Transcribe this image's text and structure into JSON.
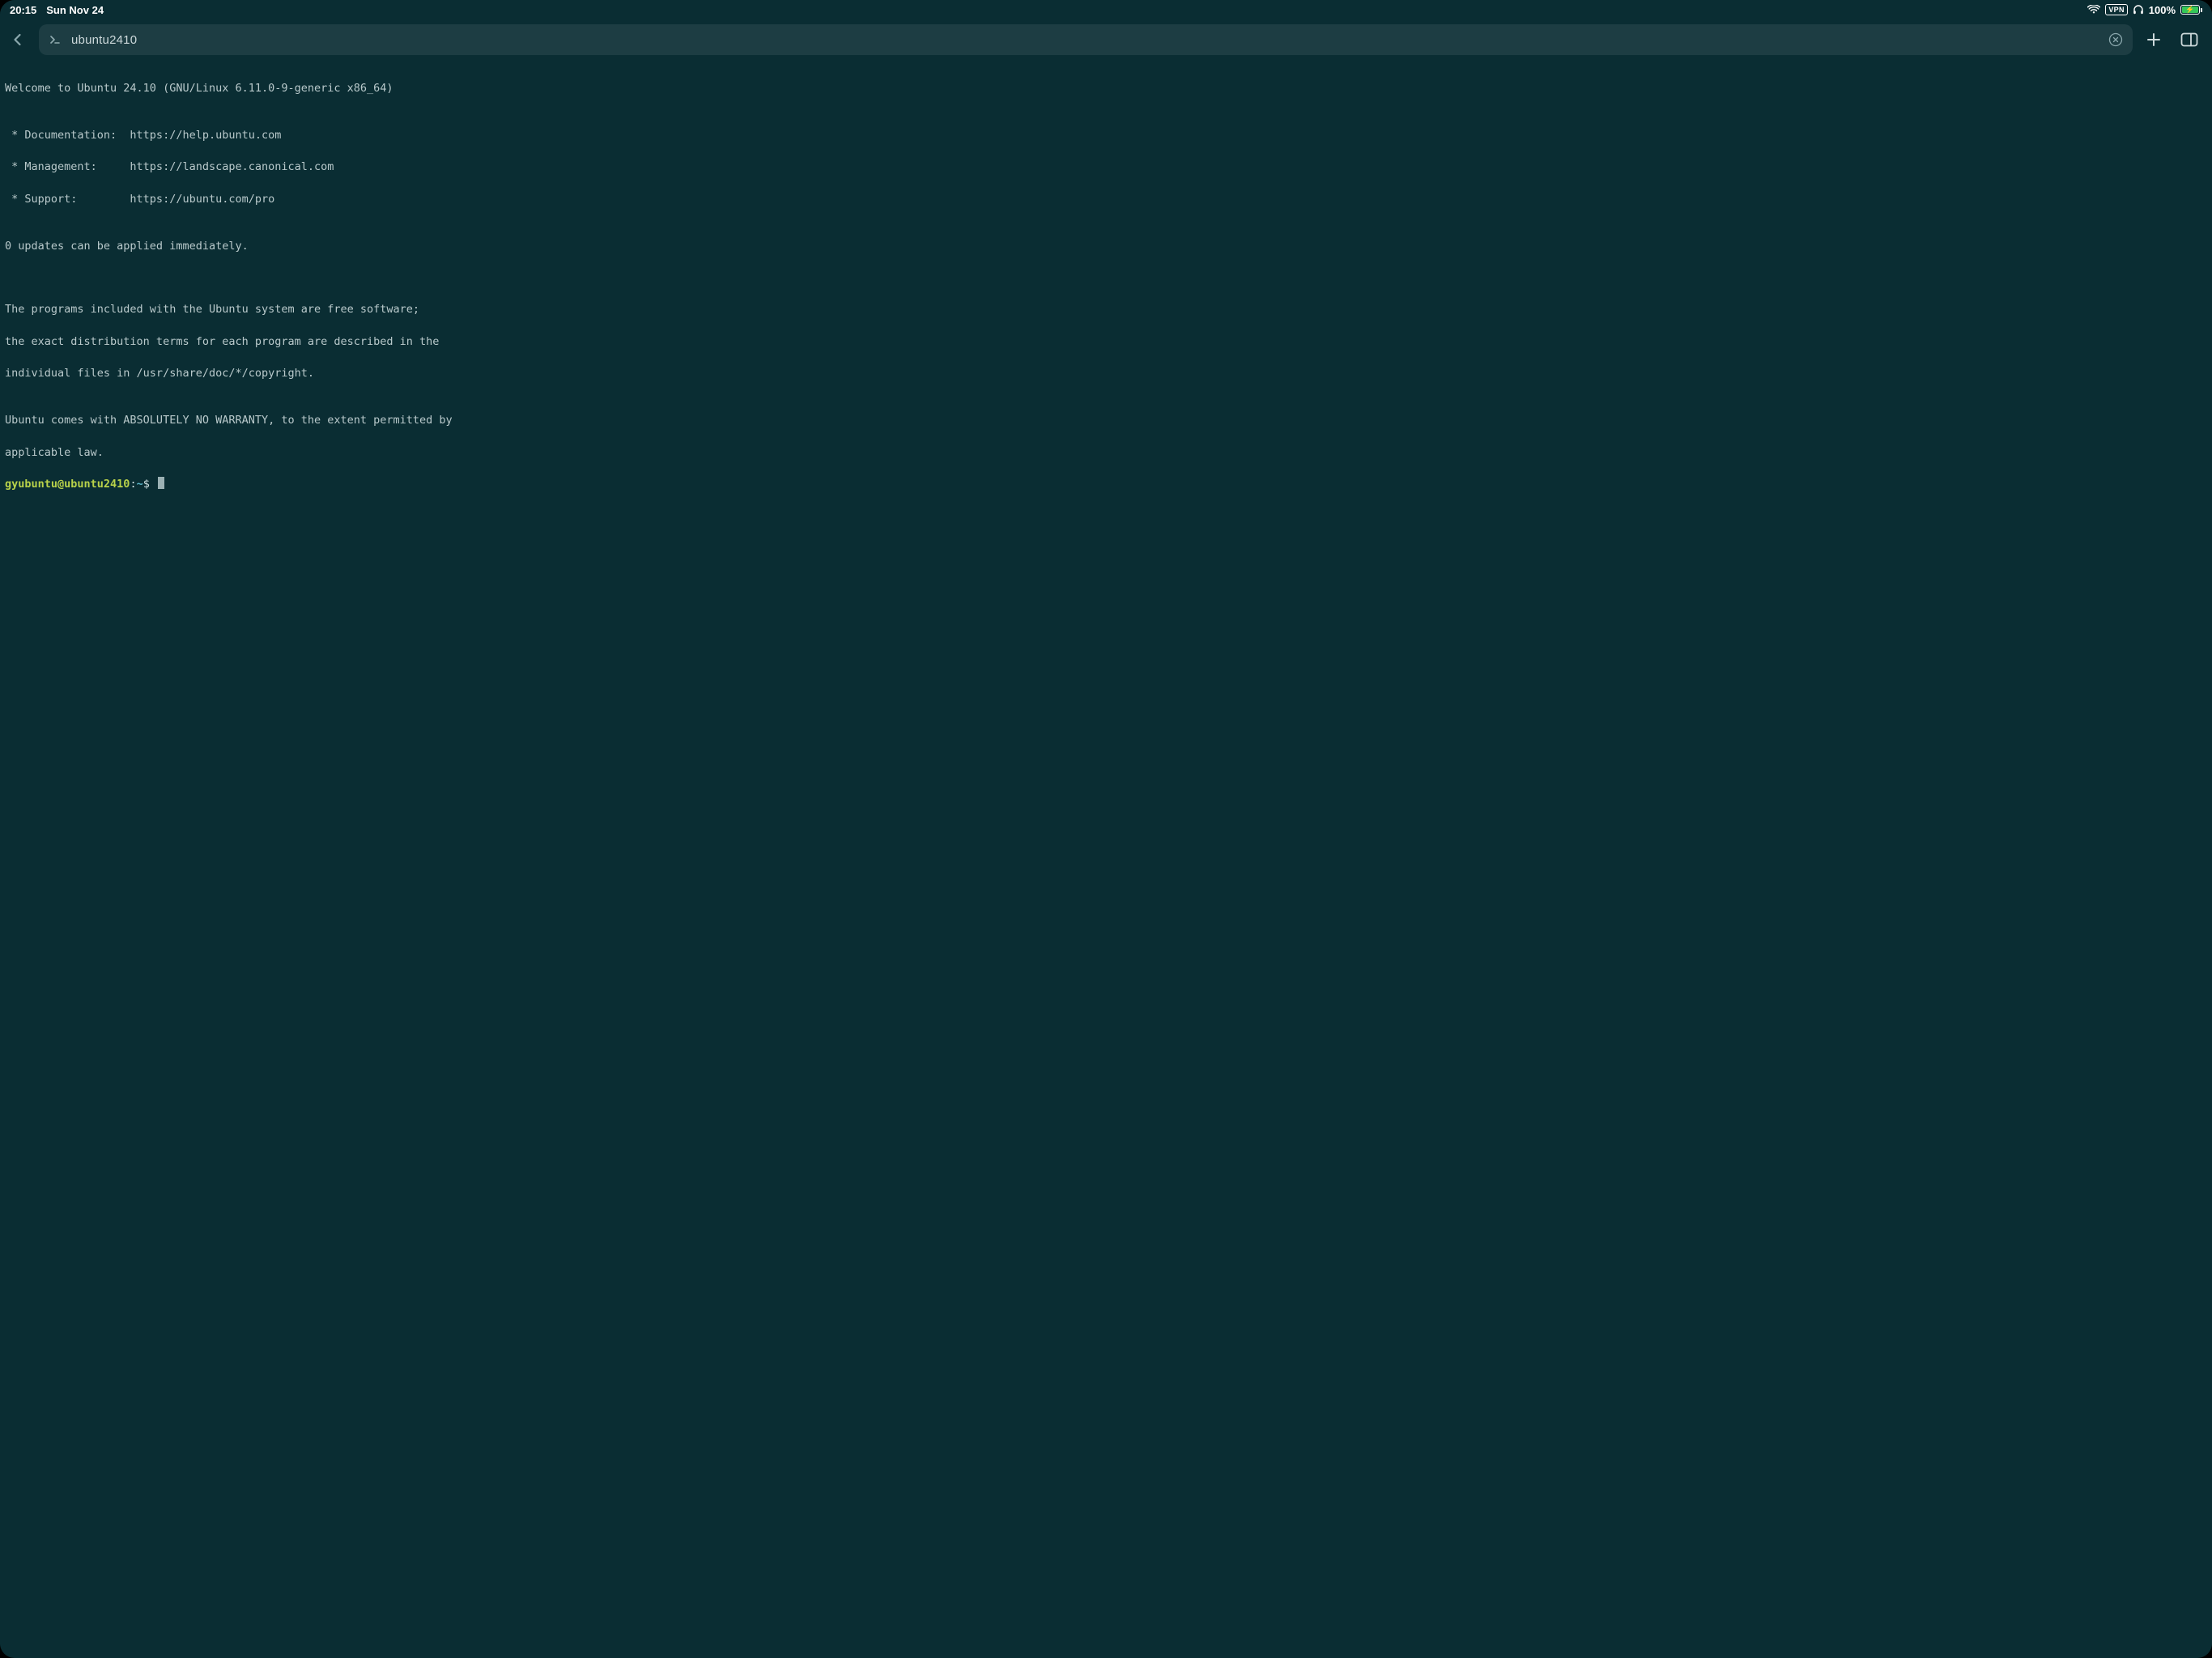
{
  "status": {
    "time": "20:15",
    "date": "Sun Nov 24",
    "vpn_label": "VPN",
    "battery_percent": "100%"
  },
  "toolbar": {
    "address": "ubuntu2410"
  },
  "terminal": {
    "lines": [
      "Welcome to Ubuntu 24.10 (GNU/Linux 6.11.0-9-generic x86_64)",
      "",
      " * Documentation:  https://help.ubuntu.com",
      " * Management:     https://landscape.canonical.com",
      " * Support:        https://ubuntu.com/pro",
      "",
      "0 updates can be applied immediately.",
      "",
      "",
      "The programs included with the Ubuntu system are free software;",
      "the exact distribution terms for each program are described in the",
      "individual files in /usr/share/doc/*/copyright.",
      "",
      "Ubuntu comes with ABSOLUTELY NO WARRANTY, to the extent permitted by",
      "applicable law."
    ],
    "prompt": {
      "user_host": "gyubuntu@ubuntu2410",
      "separator": ":",
      "path": "~",
      "suffix": "$"
    }
  }
}
